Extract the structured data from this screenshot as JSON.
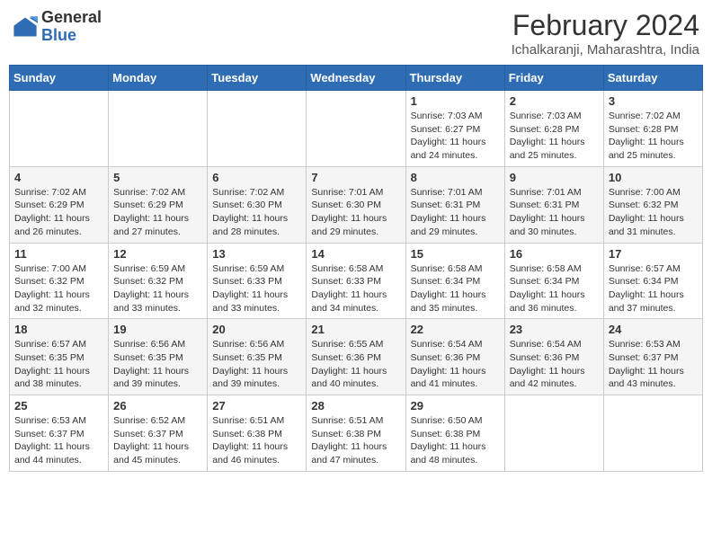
{
  "logo": {
    "general": "General",
    "blue": "Blue"
  },
  "header": {
    "month": "February 2024",
    "location": "Ichalkaranji, Maharashtra, India"
  },
  "weekdays": [
    "Sunday",
    "Monday",
    "Tuesday",
    "Wednesday",
    "Thursday",
    "Friday",
    "Saturday"
  ],
  "weeks": [
    [
      {
        "day": "",
        "info": ""
      },
      {
        "day": "",
        "info": ""
      },
      {
        "day": "",
        "info": ""
      },
      {
        "day": "",
        "info": ""
      },
      {
        "day": "1",
        "info": "Sunrise: 7:03 AM\nSunset: 6:27 PM\nDaylight: 11 hours and 24 minutes."
      },
      {
        "day": "2",
        "info": "Sunrise: 7:03 AM\nSunset: 6:28 PM\nDaylight: 11 hours and 25 minutes."
      },
      {
        "day": "3",
        "info": "Sunrise: 7:02 AM\nSunset: 6:28 PM\nDaylight: 11 hours and 25 minutes."
      }
    ],
    [
      {
        "day": "4",
        "info": "Sunrise: 7:02 AM\nSunset: 6:29 PM\nDaylight: 11 hours and 26 minutes."
      },
      {
        "day": "5",
        "info": "Sunrise: 7:02 AM\nSunset: 6:29 PM\nDaylight: 11 hours and 27 minutes."
      },
      {
        "day": "6",
        "info": "Sunrise: 7:02 AM\nSunset: 6:30 PM\nDaylight: 11 hours and 28 minutes."
      },
      {
        "day": "7",
        "info": "Sunrise: 7:01 AM\nSunset: 6:30 PM\nDaylight: 11 hours and 29 minutes."
      },
      {
        "day": "8",
        "info": "Sunrise: 7:01 AM\nSunset: 6:31 PM\nDaylight: 11 hours and 29 minutes."
      },
      {
        "day": "9",
        "info": "Sunrise: 7:01 AM\nSunset: 6:31 PM\nDaylight: 11 hours and 30 minutes."
      },
      {
        "day": "10",
        "info": "Sunrise: 7:00 AM\nSunset: 6:32 PM\nDaylight: 11 hours and 31 minutes."
      }
    ],
    [
      {
        "day": "11",
        "info": "Sunrise: 7:00 AM\nSunset: 6:32 PM\nDaylight: 11 hours and 32 minutes."
      },
      {
        "day": "12",
        "info": "Sunrise: 6:59 AM\nSunset: 6:32 PM\nDaylight: 11 hours and 33 minutes."
      },
      {
        "day": "13",
        "info": "Sunrise: 6:59 AM\nSunset: 6:33 PM\nDaylight: 11 hours and 33 minutes."
      },
      {
        "day": "14",
        "info": "Sunrise: 6:58 AM\nSunset: 6:33 PM\nDaylight: 11 hours and 34 minutes."
      },
      {
        "day": "15",
        "info": "Sunrise: 6:58 AM\nSunset: 6:34 PM\nDaylight: 11 hours and 35 minutes."
      },
      {
        "day": "16",
        "info": "Sunrise: 6:58 AM\nSunset: 6:34 PM\nDaylight: 11 hours and 36 minutes."
      },
      {
        "day": "17",
        "info": "Sunrise: 6:57 AM\nSunset: 6:34 PM\nDaylight: 11 hours and 37 minutes."
      }
    ],
    [
      {
        "day": "18",
        "info": "Sunrise: 6:57 AM\nSunset: 6:35 PM\nDaylight: 11 hours and 38 minutes."
      },
      {
        "day": "19",
        "info": "Sunrise: 6:56 AM\nSunset: 6:35 PM\nDaylight: 11 hours and 39 minutes."
      },
      {
        "day": "20",
        "info": "Sunrise: 6:56 AM\nSunset: 6:35 PM\nDaylight: 11 hours and 39 minutes."
      },
      {
        "day": "21",
        "info": "Sunrise: 6:55 AM\nSunset: 6:36 PM\nDaylight: 11 hours and 40 minutes."
      },
      {
        "day": "22",
        "info": "Sunrise: 6:54 AM\nSunset: 6:36 PM\nDaylight: 11 hours and 41 minutes."
      },
      {
        "day": "23",
        "info": "Sunrise: 6:54 AM\nSunset: 6:36 PM\nDaylight: 11 hours and 42 minutes."
      },
      {
        "day": "24",
        "info": "Sunrise: 6:53 AM\nSunset: 6:37 PM\nDaylight: 11 hours and 43 minutes."
      }
    ],
    [
      {
        "day": "25",
        "info": "Sunrise: 6:53 AM\nSunset: 6:37 PM\nDaylight: 11 hours and 44 minutes."
      },
      {
        "day": "26",
        "info": "Sunrise: 6:52 AM\nSunset: 6:37 PM\nDaylight: 11 hours and 45 minutes."
      },
      {
        "day": "27",
        "info": "Sunrise: 6:51 AM\nSunset: 6:38 PM\nDaylight: 11 hours and 46 minutes."
      },
      {
        "day": "28",
        "info": "Sunrise: 6:51 AM\nSunset: 6:38 PM\nDaylight: 11 hours and 47 minutes."
      },
      {
        "day": "29",
        "info": "Sunrise: 6:50 AM\nSunset: 6:38 PM\nDaylight: 11 hours and 48 minutes."
      },
      {
        "day": "",
        "info": ""
      },
      {
        "day": "",
        "info": ""
      }
    ]
  ]
}
